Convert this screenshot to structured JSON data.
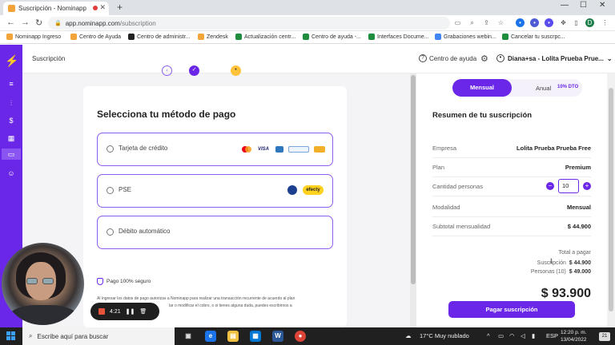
{
  "browser": {
    "tab_title": "Suscripción - Nominapp",
    "url_host": "app.nominapp.com",
    "url_path": "/subscription",
    "bookmarks": [
      {
        "label": "Nominapp Ingreso",
        "color": "#f2a33a"
      },
      {
        "label": "Centro de Ayuda",
        "color": "#f2a33a"
      },
      {
        "label": "Centro de administr...",
        "color": "#222222"
      },
      {
        "label": "Zendesk",
        "color": "#f2a33a"
      },
      {
        "label": "Actualización centr...",
        "color": "#1e8e3e"
      },
      {
        "label": "Centro de ayuda -...",
        "color": "#1e8e3e"
      },
      {
        "label": "Interfaces Docume...",
        "color": "#1e8e3e"
      },
      {
        "label": "Grabaciones webin...",
        "color": "#4285f4"
      },
      {
        "label": "Cancelar tu suscrpc...",
        "color": "#1e8e3e"
      }
    ],
    "profile_initial": "D"
  },
  "app": {
    "header_title": "Suscripción",
    "help_label": "Centro de ayuda",
    "user_label": "Diana+sa - Lolita Prueba Prue...",
    "accent": "#6a27e8"
  },
  "payment": {
    "title": "Selecciona tu método de pago",
    "options": [
      {
        "label": "Tarjeta de crédito"
      },
      {
        "label": "PSE"
      },
      {
        "label": "Débito automático"
      }
    ],
    "card_brands": [
      "VISA"
    ],
    "efecty_label": "efecty",
    "secure_label": "Pago 100% seguro",
    "legal_line1": "Al ingresar los datos de pago autorizas a Nominapp para realizar una transacción recurrente de acuerdo al plan",
    "legal_line2": "lar o modificar el cobro, o si tienes alguna duda, puedes escribirnos a"
  },
  "summary": {
    "toggle_monthly": "Mensual",
    "toggle_annual": "Anual",
    "annual_discount": "10% DTO",
    "title": "Resumen de tu suscripción",
    "rows": [
      {
        "key": "Empresa",
        "value": "Lolita Prueba Prueba Free"
      },
      {
        "key": "Plan",
        "value": "Premium"
      },
      {
        "key": "Cantidad personas",
        "value": "10"
      },
      {
        "key": "Modalidad",
        "value": "Mensual"
      },
      {
        "key": "Subtotal mensualidad",
        "value": "$ 44.900"
      }
    ],
    "total_label": "Total a pagar",
    "suscripcion_label": "Suscripción",
    "suscripcion_value": "$ 44.900",
    "personas_label": "Personas (10)",
    "personas_value": "$ 49.000",
    "total_value": "$ 93.900",
    "pay_button": "Pagar suscripción"
  },
  "recorder": {
    "time": "4:21"
  },
  "taskbar": {
    "search_placeholder": "Escribe aquí para buscar",
    "weather": "17°C  Muy nublado",
    "lang": "ESP",
    "time": "12:20 p. m.",
    "date": "13/04/2022",
    "notif_count": "21"
  }
}
